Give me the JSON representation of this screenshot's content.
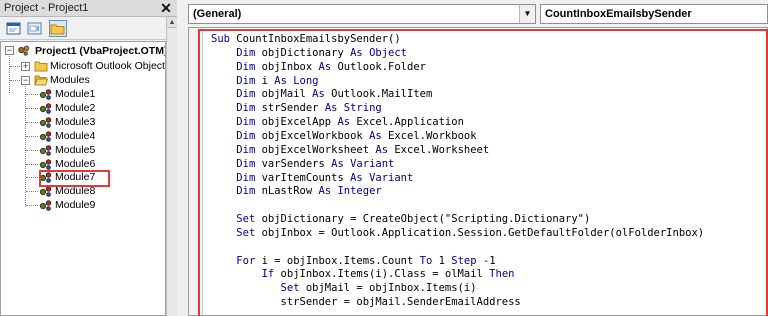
{
  "project_explorer": {
    "title": "Project - Project1",
    "close_glyph": "✕",
    "toolbar": {
      "view_code_icon": "view-code-icon",
      "view_object_icon": "view-object-icon",
      "toggle_folders_icon": "toggle-folders-icon"
    },
    "tree": {
      "root_label": "Project1 (VbaProject.OTM)",
      "folders": [
        {
          "label": "Microsoft Outlook Objects",
          "expander": "+"
        },
        {
          "label": "Modules",
          "expander": "−"
        }
      ],
      "modules": [
        "Module1",
        "Module2",
        "Module3",
        "Module4",
        "Module5",
        "Module6",
        "Module7",
        "Module8",
        "Module9"
      ],
      "selected_module": "Module7"
    }
  },
  "code_window": {
    "object_dropdown": "(General)",
    "procedure_dropdown": "CountInboxEmailsbySender",
    "lines": [
      [
        {
          "t": "Sub ",
          "k": true
        },
        {
          "t": "CountInboxEmailsbySender()"
        }
      ],
      [
        {
          "t": "    "
        },
        {
          "t": "Dim ",
          "k": true
        },
        {
          "t": "objDictionary "
        },
        {
          "t": "As ",
          "k": true
        },
        {
          "t": "Object",
          "k": true
        }
      ],
      [
        {
          "t": "    "
        },
        {
          "t": "Dim ",
          "k": true
        },
        {
          "t": "objInbox "
        },
        {
          "t": "As ",
          "k": true
        },
        {
          "t": "Outlook.Folder"
        }
      ],
      [
        {
          "t": "    "
        },
        {
          "t": "Dim ",
          "k": true
        },
        {
          "t": "i "
        },
        {
          "t": "As ",
          "k": true
        },
        {
          "t": "Long",
          "k": true
        }
      ],
      [
        {
          "t": "    "
        },
        {
          "t": "Dim ",
          "k": true
        },
        {
          "t": "objMail "
        },
        {
          "t": "As ",
          "k": true
        },
        {
          "t": "Outlook.MailItem"
        }
      ],
      [
        {
          "t": "    "
        },
        {
          "t": "Dim ",
          "k": true
        },
        {
          "t": "strSender "
        },
        {
          "t": "As ",
          "k": true
        },
        {
          "t": "String",
          "k": true
        }
      ],
      [
        {
          "t": "    "
        },
        {
          "t": "Dim ",
          "k": true
        },
        {
          "t": "objExcelApp "
        },
        {
          "t": "As ",
          "k": true
        },
        {
          "t": "Excel.Application"
        }
      ],
      [
        {
          "t": "    "
        },
        {
          "t": "Dim ",
          "k": true
        },
        {
          "t": "objExcelWorkbook "
        },
        {
          "t": "As ",
          "k": true
        },
        {
          "t": "Excel.Workbook"
        }
      ],
      [
        {
          "t": "    "
        },
        {
          "t": "Dim ",
          "k": true
        },
        {
          "t": "objExcelWorksheet "
        },
        {
          "t": "As ",
          "k": true
        },
        {
          "t": "Excel.Worksheet"
        }
      ],
      [
        {
          "t": "    "
        },
        {
          "t": "Dim ",
          "k": true
        },
        {
          "t": "varSenders "
        },
        {
          "t": "As ",
          "k": true
        },
        {
          "t": "Variant",
          "k": true
        }
      ],
      [
        {
          "t": "    "
        },
        {
          "t": "Dim ",
          "k": true
        },
        {
          "t": "varItemCounts "
        },
        {
          "t": "As ",
          "k": true
        },
        {
          "t": "Variant",
          "k": true
        }
      ],
      [
        {
          "t": "    "
        },
        {
          "t": "Dim ",
          "k": true
        },
        {
          "t": "nLastRow "
        },
        {
          "t": "As ",
          "k": true
        },
        {
          "t": "Integer",
          "k": true
        }
      ],
      [
        {
          "t": ""
        }
      ],
      [
        {
          "t": "    "
        },
        {
          "t": "Set ",
          "k": true
        },
        {
          "t": "objDictionary = CreateObject(\"Scripting.Dictionary\")"
        }
      ],
      [
        {
          "t": "    "
        },
        {
          "t": "Set ",
          "k": true
        },
        {
          "t": "objInbox = Outlook.Application.Session.GetDefaultFolder(olFolderInbox)"
        }
      ],
      [
        {
          "t": ""
        }
      ],
      [
        {
          "t": "    "
        },
        {
          "t": "For ",
          "k": true
        },
        {
          "t": "i = objInbox.Items.Count "
        },
        {
          "t": "To ",
          "k": true
        },
        {
          "t": "1 "
        },
        {
          "t": "Step ",
          "k": true
        },
        {
          "t": "-1"
        }
      ],
      [
        {
          "t": "        "
        },
        {
          "t": "If ",
          "k": true
        },
        {
          "t": "objInbox.Items(i).Class = olMail "
        },
        {
          "t": "Then",
          "k": true
        }
      ],
      [
        {
          "t": "           "
        },
        {
          "t": "Set ",
          "k": true
        },
        {
          "t": "objMail = objInbox.Items(i)"
        }
      ],
      [
        {
          "t": "           strSender = objMail.SenderEmailAddress"
        }
      ]
    ]
  },
  "colors": {
    "keyword": "#00008b",
    "highlight_box": "#e0393c"
  }
}
